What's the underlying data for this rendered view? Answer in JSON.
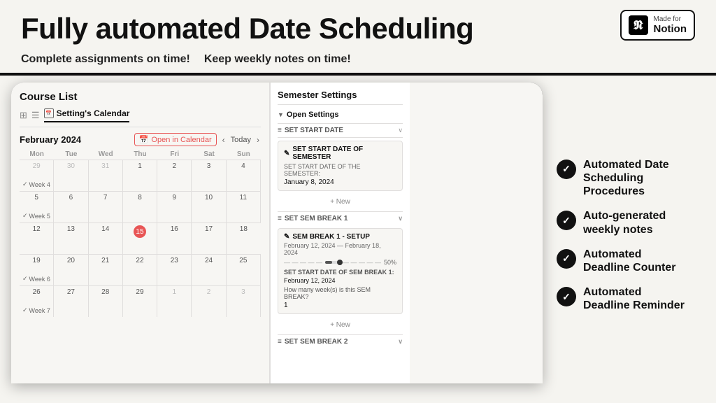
{
  "header": {
    "title": "Fully automated Date Scheduling",
    "subtitle_part1": "Complete assignments on time!",
    "subtitle_part2": "Keep weekly notes on time!",
    "notion_badge": {
      "made_for": "Made for",
      "brand": "Notion"
    }
  },
  "course_panel": {
    "title": "Course List",
    "tabs": [
      {
        "label": "grid",
        "icon": "⊞",
        "active": false
      },
      {
        "label": "list",
        "icon": "☰",
        "active": false
      },
      {
        "label": "Setting's Calendar",
        "active": true
      }
    ],
    "calendar": {
      "month_year": "February 2024",
      "open_btn": "Open in Calendar",
      "today_btn": "Today",
      "days": [
        "Mon",
        "Tue",
        "Wed",
        "Thu",
        "Fri",
        "Sat",
        "Sun"
      ],
      "weeks": [
        {
          "cells": [
            "29",
            "30",
            "31",
            "Feb 1",
            "2",
            "3",
            "4"
          ],
          "other_month_count": 3,
          "week_label": "✓ Week 4"
        },
        {
          "cells": [
            "5",
            "6",
            "7",
            "8",
            "9",
            "10",
            "11"
          ],
          "week_label": "✓ Week 5"
        },
        {
          "cells": [
            "12",
            "13",
            "14",
            "15",
            "16",
            "17",
            "18"
          ],
          "today_cell": 3,
          "week_label": null
        },
        {
          "cells": [
            "19",
            "20",
            "21",
            "22",
            "23",
            "24",
            "25"
          ],
          "week_label": "✓ Week 6"
        },
        {
          "cells": [
            "26",
            "27",
            "28",
            "29",
            "Mar 1",
            "2",
            "3"
          ],
          "other_month_end": 2,
          "week_label": "✓ Week 7"
        }
      ]
    }
  },
  "semester_panel": {
    "title": "Semester Settings",
    "open_settings_label": "Open Settings",
    "set_start_date_label": "SET START DATE",
    "set_start_date_item": {
      "title": "SET START DATE OF SEMESTER",
      "sub": "SET START DATE OF THE SEMESTER:",
      "value": "January 8, 2024"
    },
    "new_btn": "+ New",
    "sem_break1_label": "SET SEM BREAK 1",
    "sem_break1_item": {
      "title": "SEM BREAK 1 - SETUP",
      "dates": "February 12, 2024 — February 18, 2024",
      "progress": 50,
      "progress_pct": "50%",
      "start_date_label": "SET START DATE OF SEM BREAK 1:",
      "start_date_value": "February 12, 2024",
      "weeks_question": "How many week(s) is this SEM BREAK?",
      "weeks_value": "1"
    },
    "new_btn2": "+ New",
    "sem_break2_label": "SET SEM BREAK 2"
  },
  "features": [
    {
      "text": "Automated Date\nScheduling Procedures"
    },
    {
      "text": "Auto-generated\nweekly notes"
    },
    {
      "text": "Automated\nDeadline Counter"
    },
    {
      "text": "Automated\nDeadline Reminder"
    }
  ]
}
